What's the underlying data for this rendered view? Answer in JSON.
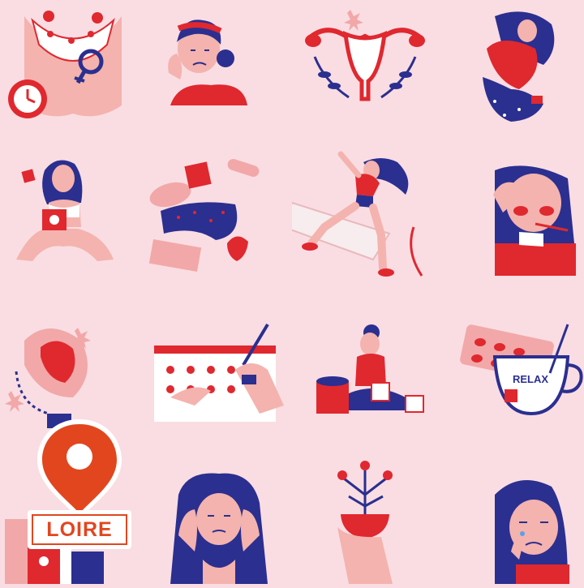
{
  "image": {
    "background_color": "#f9dde3",
    "palette": {
      "red": "#e0282f",
      "navy": "#2b2f8f",
      "pink": "#f2a8a8",
      "skin": "#f4b3ae",
      "white": "#ffffff"
    },
    "illustrations": [
      {
        "name": "menstrual-cycle-body-icon"
      },
      {
        "name": "woman-headache-portrait"
      },
      {
        "name": "uterus-ovaries-icon"
      },
      {
        "name": "woman-curled-cramps"
      },
      {
        "name": "woman-holding-pads"
      },
      {
        "name": "underwear-pads-pills-cup"
      },
      {
        "name": "woman-jumping-on-pad"
      },
      {
        "name": "woman-fever-thermometer"
      },
      {
        "name": "sanitary-pad-flowers"
      },
      {
        "name": "period-calendar-hands"
      },
      {
        "name": "woman-sitting-sweets"
      },
      {
        "name": "pills-and-relax-tea-cup"
      },
      {
        "name": "cosmetics-bottles"
      },
      {
        "name": "woman-hands-on-head"
      },
      {
        "name": "hand-holding-flowers"
      },
      {
        "name": "woman-crying"
      }
    ],
    "tea_cup_text": "RELAX"
  },
  "badge": {
    "label": "LOIRE",
    "pin_color": "#e2461f",
    "icon": "map-pin-icon"
  }
}
